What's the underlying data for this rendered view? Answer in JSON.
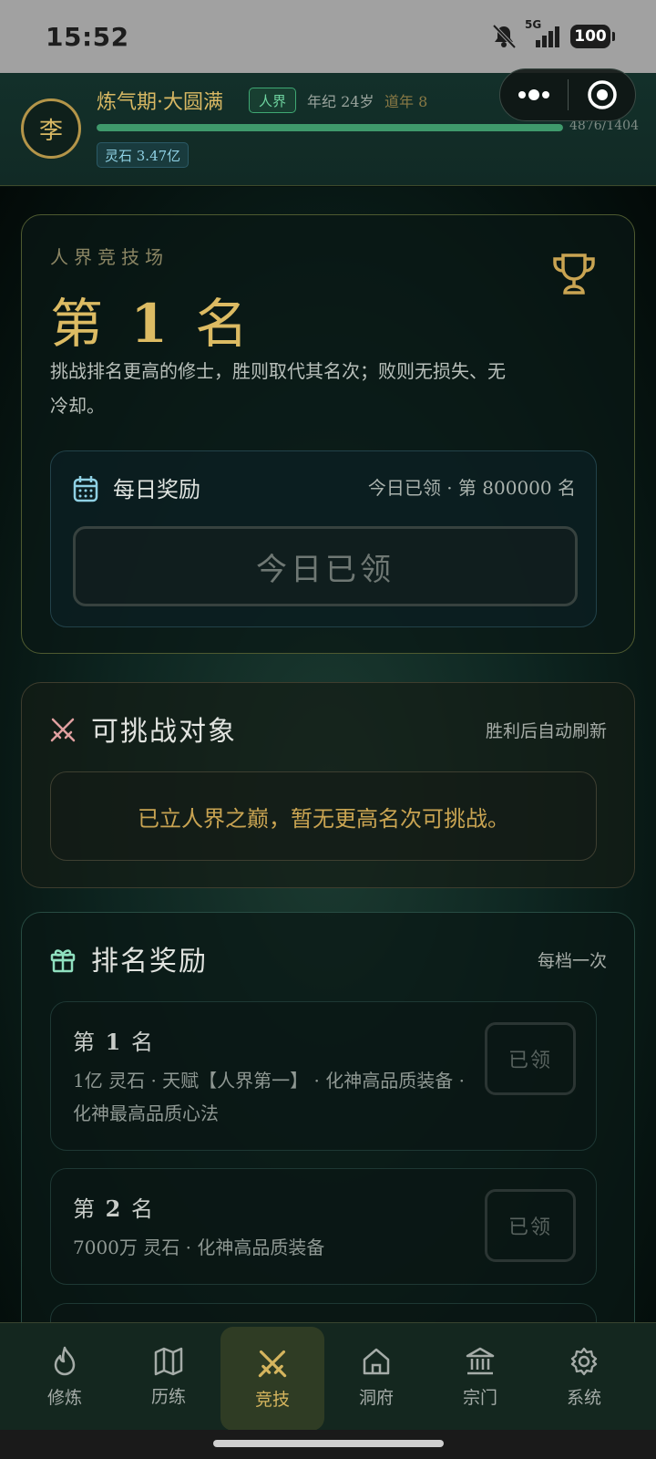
{
  "status_bar": {
    "time": "15:52",
    "network": "5G",
    "battery": "100"
  },
  "header": {
    "avatar": "李",
    "realm": "炼气期·大圆满",
    "world_badge": "人界",
    "age": "年纪 24岁",
    "dao_years": "道年 8",
    "xp_text": "4876/1404",
    "xp_fraction": 1.0,
    "lingshi": "灵石 3.47亿"
  },
  "arena": {
    "label": "人界竞技场",
    "rank_prefix": "第",
    "rank_num": "1",
    "rank_suffix": "名",
    "description": "挑战排名更高的修士，胜则取代其名次；败则无损失、无冷却。",
    "daily": {
      "title": "每日奖励",
      "status": "今日已领 · 第 800000 名",
      "button": "今日已领"
    }
  },
  "challenge": {
    "title": "可挑战对象",
    "right": "胜利后自动刷新",
    "notice": "已立人界之巅，暂无更高名次可挑战。"
  },
  "rank_rewards": {
    "title": "排名奖励",
    "right": "每档一次",
    "items": [
      {
        "prefix": "第",
        "num": "1",
        "suffix": "名",
        "desc": "1亿 灵石 · 天赋【人界第一】 · 化神高品质装备 · 化神最高品质心法",
        "button": "已领"
      },
      {
        "prefix": "第",
        "num": "2",
        "suffix": "名",
        "desc": "7000万 灵石 · 化神高品质装备",
        "button": "已领"
      }
    ]
  },
  "tabs": [
    {
      "label": "修炼",
      "icon": "flame-icon"
    },
    {
      "label": "历练",
      "icon": "map-icon"
    },
    {
      "label": "竞技",
      "icon": "crossed-swords-icon",
      "active": true
    },
    {
      "label": "洞府",
      "icon": "house-icon"
    },
    {
      "label": "宗门",
      "icon": "temple-icon"
    },
    {
      "label": "系统",
      "icon": "gear-icon"
    }
  ],
  "colors": {
    "gold": "#dcbb63",
    "green_accent": "#3f9a6c",
    "teal_accent": "#8fd1e4",
    "background": "#05100d"
  }
}
